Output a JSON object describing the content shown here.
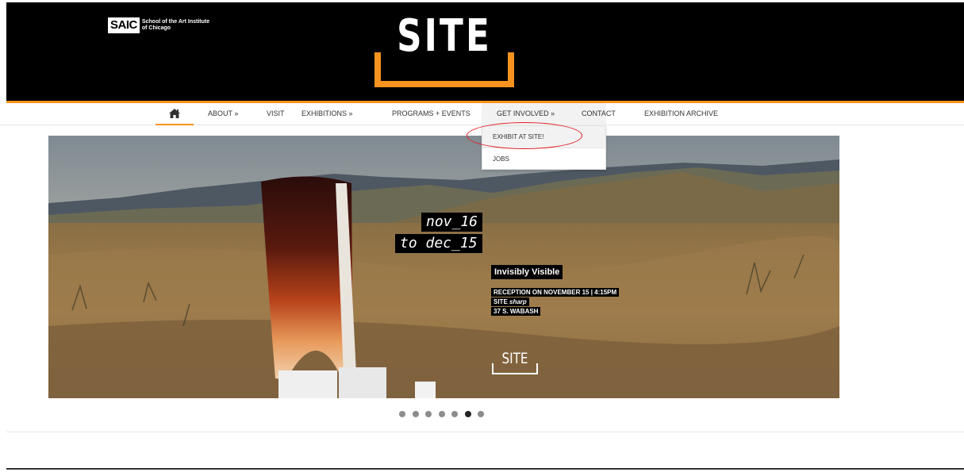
{
  "header": {
    "saic_short": "SAIC",
    "saic_full_line1": "School of the Art Institute",
    "saic_full_line2": "of Chicago",
    "site_logo": "SITE",
    "accent_color": "#f7931e"
  },
  "nav": {
    "home_icon": "home-icon",
    "items": [
      {
        "label": "ABOUT »"
      },
      {
        "label": "VISIT"
      },
      {
        "label": "EXHIBITIONS »"
      },
      {
        "label": "PROGRAMS + EVENTS"
      },
      {
        "label": "GET INVOLVED »"
      },
      {
        "label": "CONTACT"
      },
      {
        "label": "EXHIBITION ARCHIVE"
      }
    ]
  },
  "dropdown": {
    "items": [
      {
        "label": "EXHIBIT AT SITE!"
      },
      {
        "label": "JOBS"
      }
    ]
  },
  "slide": {
    "date_line1": "nov_16",
    "date_line2": "to dec_15",
    "title": "Invisibly Visible",
    "line1": "RECEPTION ON NOVEMBER 15 | 4:15PM",
    "line2_a": "SITE ",
    "line2_b": "sharp",
    "line3": "37 S. WABASH",
    "logo": "SITE"
  },
  "slider": {
    "dots": 7,
    "active_dot": 6
  },
  "annotation_color": "#e31e24"
}
